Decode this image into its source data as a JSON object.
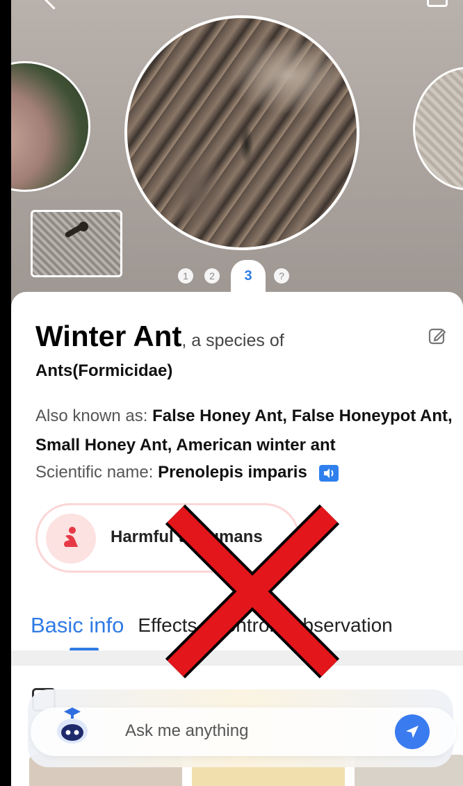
{
  "pager": {
    "pages": [
      "1",
      "2",
      "3",
      "?"
    ],
    "active_index": 2
  },
  "species": {
    "name": "Winter Ant",
    "name_suffix": ", a species of",
    "parent": "Ants(Formicidae)",
    "aka_label": "Also known as: ",
    "aka_values": "False Honey Ant, False Honeypot Ant, Small Honey Ant, American winter ant",
    "sci_label": "Scientific name: ",
    "sci_value": "Prenolepis imparis"
  },
  "badge": {
    "label": "Harmful to humans"
  },
  "tabs": [
    {
      "label": "Basic info",
      "active": true
    },
    {
      "label": "Effects"
    },
    {
      "label": "Control"
    },
    {
      "label": "Observation"
    }
  ],
  "chat": {
    "placeholder": "Ask me anything"
  },
  "colors": {
    "accent": "#2f7be5",
    "harm": "#e63946",
    "overlay_x": "#e3161b"
  },
  "icons": [
    "back-icon",
    "bookmark-icon",
    "edit-icon",
    "speaker-icon",
    "human-harm-icon",
    "section-icon",
    "robot-assistant-icon",
    "send-icon"
  ]
}
